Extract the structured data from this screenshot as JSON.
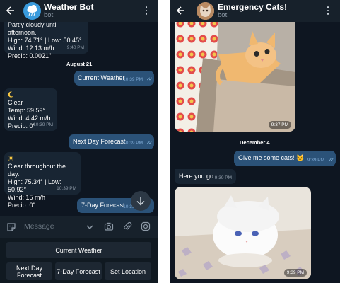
{
  "left_chat": {
    "title": "Weather Bot",
    "subtitle": "bot",
    "messages": [
      {
        "text": "Partly cloudy until afternoon.\nHigh: 74.71° | Low: 50.45°\nWind: 12.13 m/h\nPrecip: 0.0021\"",
        "time": "9:40 PM"
      },
      {
        "text": "August 21"
      },
      {
        "text": "Current Weather",
        "time": "10:39 PM"
      },
      {
        "text": "\nClear\nTemp: 59.59°\nWind: 4.42 m/h\nPrecip: 0\"",
        "time": "10:39 PM"
      },
      {
        "text": "Next Day Forecast",
        "time": "10:39 PM"
      },
      {
        "text": "\nClear throughout the day.\nHigh: 75.34° | Low: 50.92°\nWind: 15 m/h\nPrecip: 0\"",
        "time": "10:39 PM"
      },
      {
        "text": "7-Day Forecast",
        "time": "10:39 PM"
      }
    ],
    "input_placeholder": "Message",
    "keyboard": {
      "current_weather": "Current Weather",
      "next_day_forecast": "Next Day\nForecast",
      "seven_day_forecast": "7-Day Forecast",
      "set_location": "Set Location"
    }
  },
  "right_chat": {
    "title": "Emergency Cats!",
    "subtitle": "bot",
    "photo1_time": "9:37 PM",
    "date_chip": "December 4",
    "out_text": "Give me some cats! 🐱",
    "out_time": "9:39 PM",
    "in_text": "Here you go",
    "in_time": "9:39 PM",
    "photo2_time": "9:39 PM"
  },
  "colors": {
    "chat_background": "#0e1621",
    "header": "#17212b",
    "incoming_bubble": "#182533",
    "outgoing_bubble": "#2b5278",
    "secondary_text": "#8d99a6"
  }
}
